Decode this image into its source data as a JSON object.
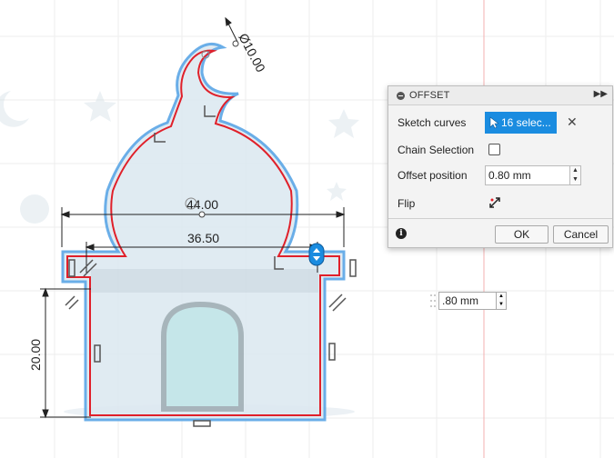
{
  "viewport": {
    "dimensions": {
      "overall_width": "44.00",
      "inner_width": "36.50",
      "height": "20.00",
      "crescent_diameter": "Ø10.00"
    }
  },
  "offset_dialog": {
    "title": "OFFSET",
    "sketch_curves_label": "Sketch curves",
    "sketch_curves_value": "16 selec...",
    "chain_selection_label": "Chain Selection",
    "chain_selection_checked": false,
    "offset_position_label": "Offset position",
    "offset_position_value": "0.80 mm",
    "flip_label": "Flip",
    "ok_label": "OK",
    "cancel_label": "Cancel"
  },
  "inline_input": {
    "value": ".80 mm"
  },
  "colors": {
    "selection_blue": "#1a8ce0",
    "offset_red": "#e0202a",
    "sketch_blue": "#5aa6e6",
    "fill_light_blue": "#dde9f1",
    "grid_line": "#eeeeee",
    "axis_red": "#f3b0b0"
  },
  "icons": [
    "collapse-icon",
    "expand-icon",
    "cursor-icon",
    "close-icon",
    "flip-icon",
    "info-icon",
    "constraint-icon"
  ]
}
